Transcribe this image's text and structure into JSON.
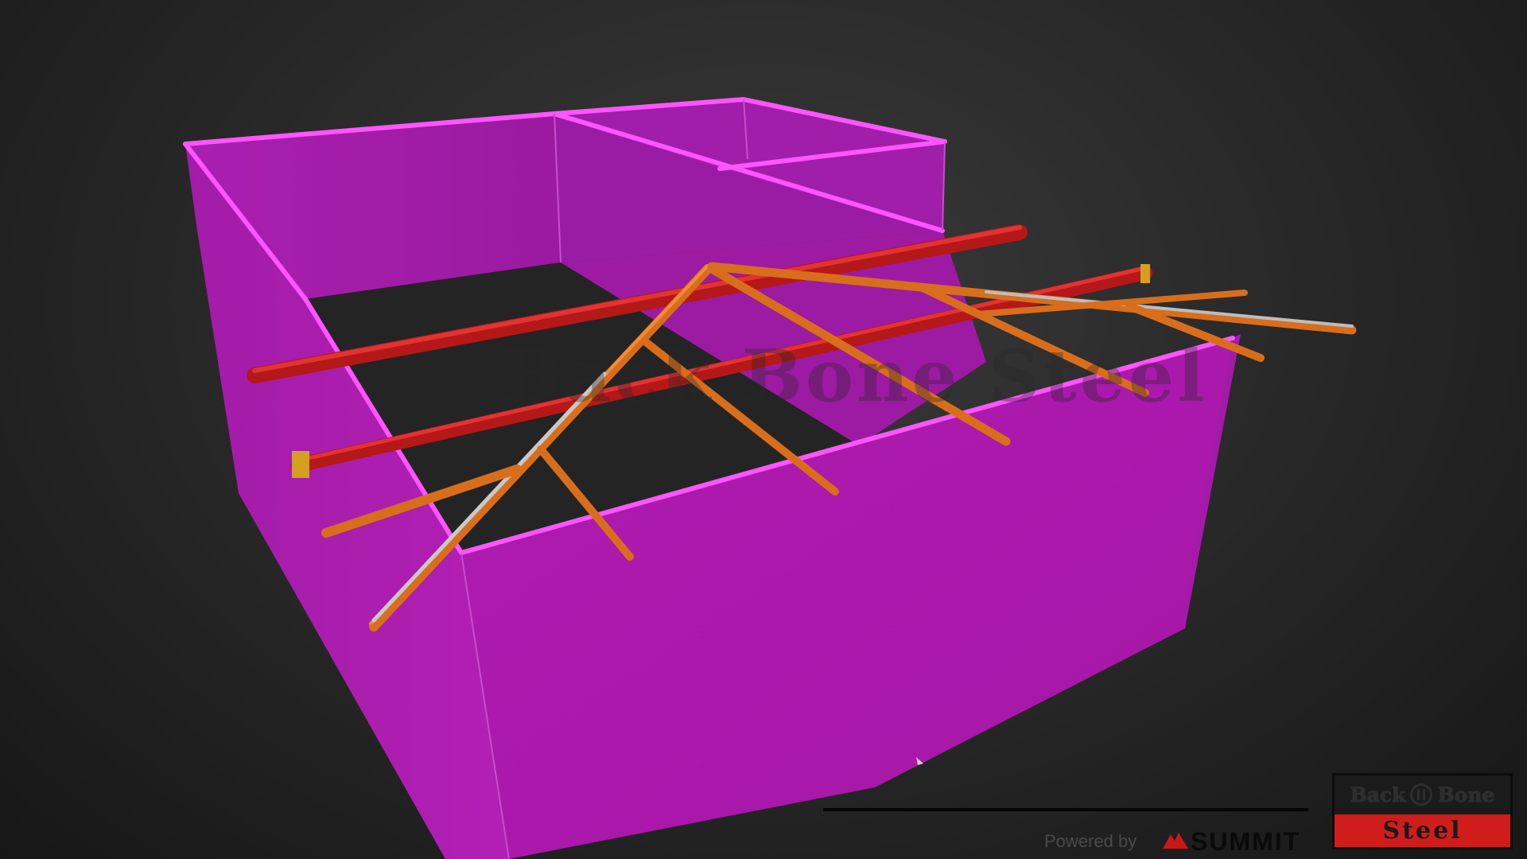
{
  "viewer": {
    "model_description_icon": "3d-steel-framing-model"
  },
  "watermark": {
    "text": "Back Bone Steel"
  },
  "footer": {
    "powered_by": "Powered by",
    "brand": "SUMMIT",
    "brand_icon": "summit-mountain-icon"
  },
  "logo": {
    "line1_left": "Back",
    "line1_right": "Bone",
    "line2": "Steel",
    "colors": {
      "accent": "#d11c1c",
      "dark": "#1b1b1b"
    }
  },
  "colors": {
    "walls": "#a81aa8",
    "wall_edges": "#ff4dff",
    "beams_red": "#d42424",
    "rafters_orange": "#e07a26",
    "background": "#262626"
  }
}
